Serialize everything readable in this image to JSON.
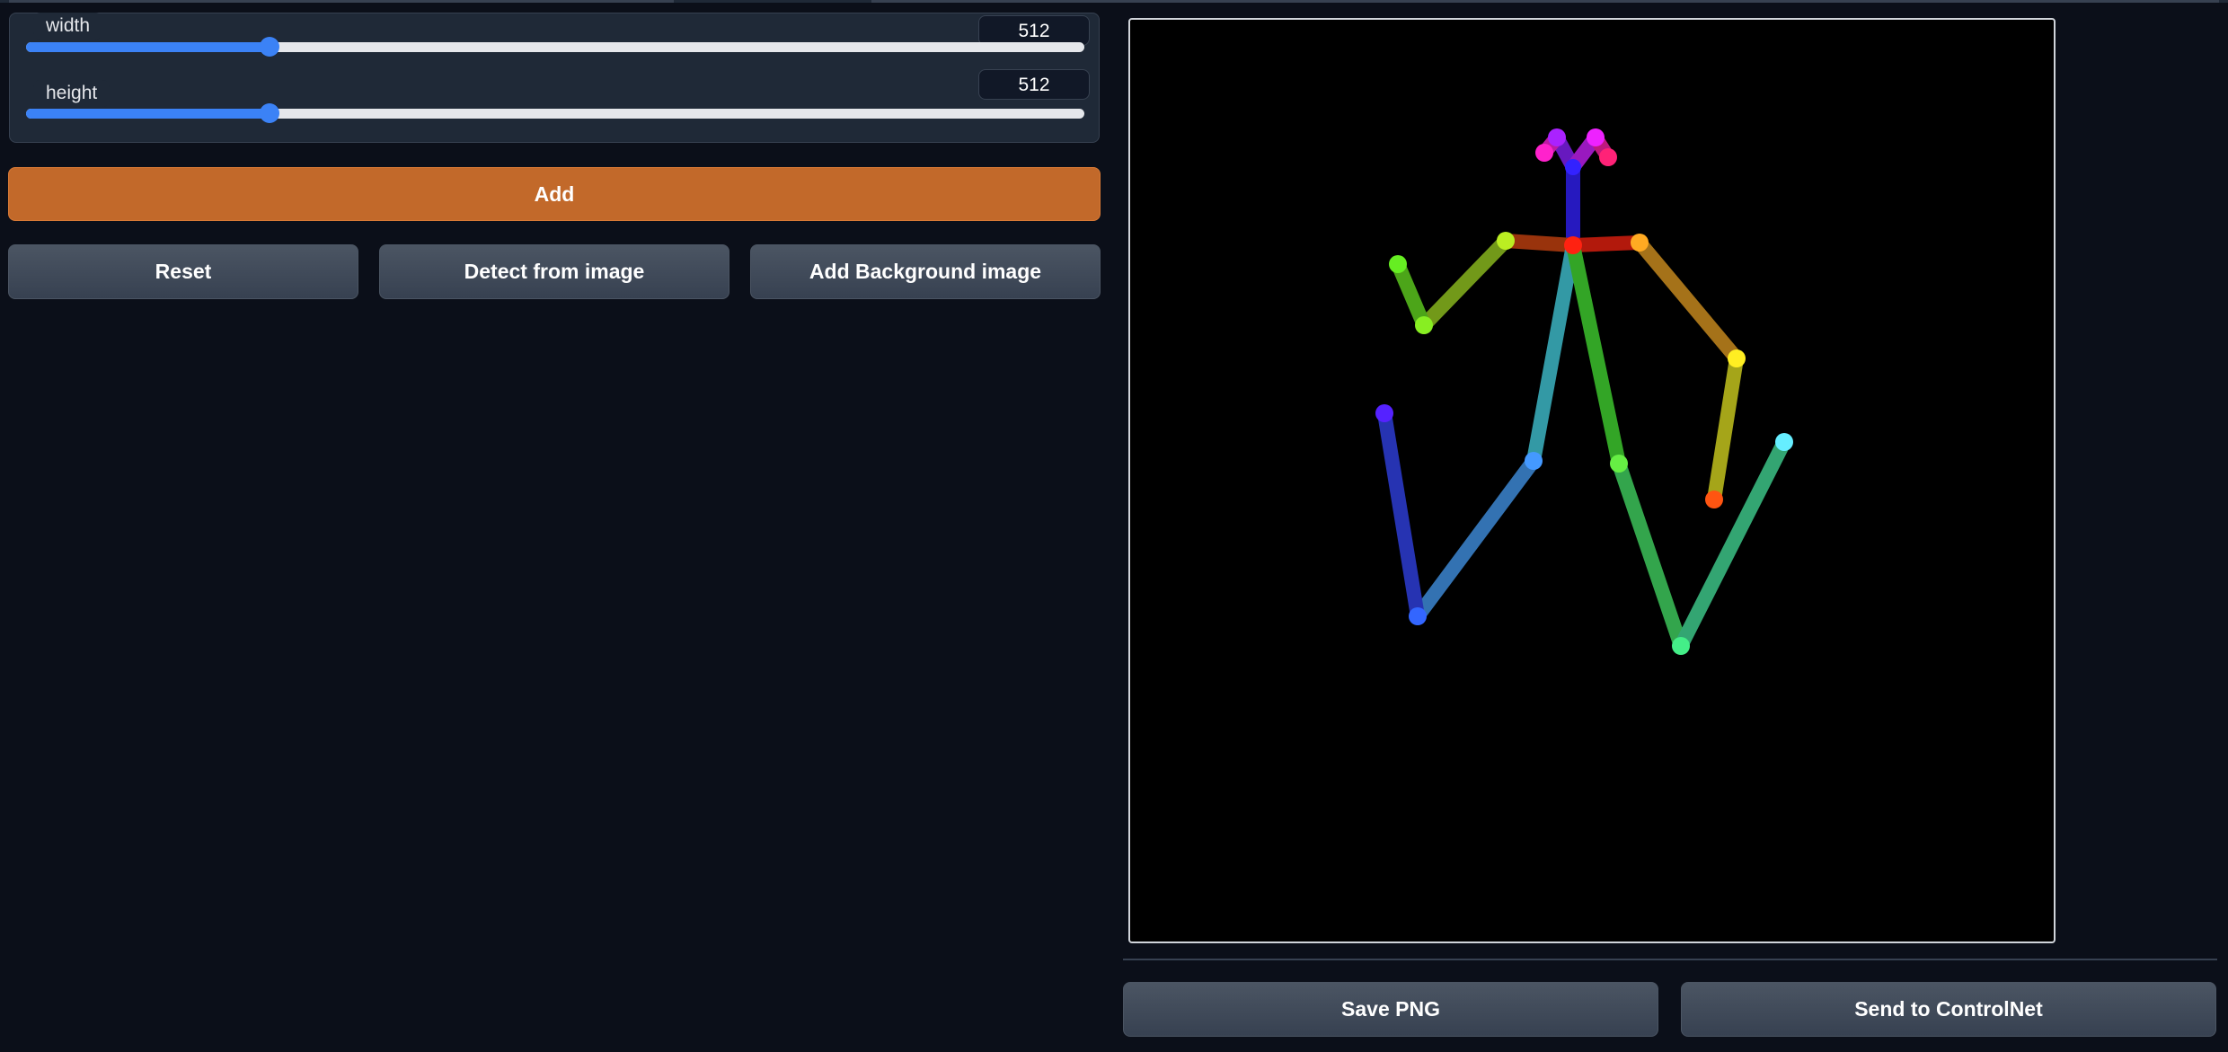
{
  "sliders": {
    "width": {
      "label": "width",
      "value": "512",
      "fraction": 0.231
    },
    "height": {
      "label": "height",
      "value": "512",
      "fraction": 0.231
    }
  },
  "buttons": {
    "add": "Add",
    "reset": "Reset",
    "detect": "Detect from image",
    "add_background": "Add Background image",
    "save_png": "Save PNG",
    "send_controlnet": "Send to ControlNet"
  },
  "colors": {
    "page_bg": "#0b0f19",
    "slider_fill": "#3b82f6",
    "add_button": "#c2692a",
    "canvas_bg": "#000000"
  }
}
